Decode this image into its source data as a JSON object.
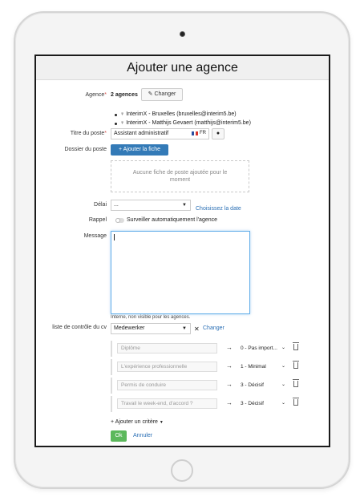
{
  "modal": {
    "title": "Ajouter une agence"
  },
  "agence": {
    "label": "Agence",
    "required_mark": "*",
    "count_text": "2 agences",
    "change_label": "Changer",
    "items": [
      "InterimX - Bruxelles (bruxelles@interim5.be)",
      "InterimX - Matthijs Gevaert (matthijs@interim5.be)"
    ]
  },
  "titre": {
    "label": "Titre du poste",
    "required_mark": "*",
    "value": "Assistant administratif",
    "lang": "FR"
  },
  "dossier": {
    "label": "Dossier du poste",
    "add_label": "Ajouter la fiche",
    "empty_text": "Aucune fiche de poste ajoutée pour le moment"
  },
  "delai": {
    "label": "Délai",
    "value": "...",
    "date_link": "Choisissez la date"
  },
  "rappel": {
    "label": "Rappel",
    "text": "Surveiller automatiquement l'agence",
    "enabled": false
  },
  "message": {
    "label": "Message",
    "value": "",
    "note": "Interne, non visible pour les agences."
  },
  "controle": {
    "label": "liste de contrôle du cv",
    "selected": "Medewerker",
    "change_label": "Changer"
  },
  "criteria": [
    {
      "placeholder": "Diplôme",
      "level": "0 - Pas import..."
    },
    {
      "placeholder": "L'expérience professionnelle",
      "level": "1 - Minimal"
    },
    {
      "placeholder": "Permis de conduire",
      "level": "3 - Décisif"
    },
    {
      "placeholder": "Travail le week-end, d'accord ?",
      "level": "3 - Décisif"
    }
  ],
  "add_criterion_label": "+ Ajouter un critère",
  "actions": {
    "ok_label": "Ok",
    "cancel_label": "Annuler"
  },
  "colors": {
    "primary": "#337ab7",
    "success": "#5cb85c",
    "link": "#2a6fb5",
    "required": "#d9534f"
  }
}
